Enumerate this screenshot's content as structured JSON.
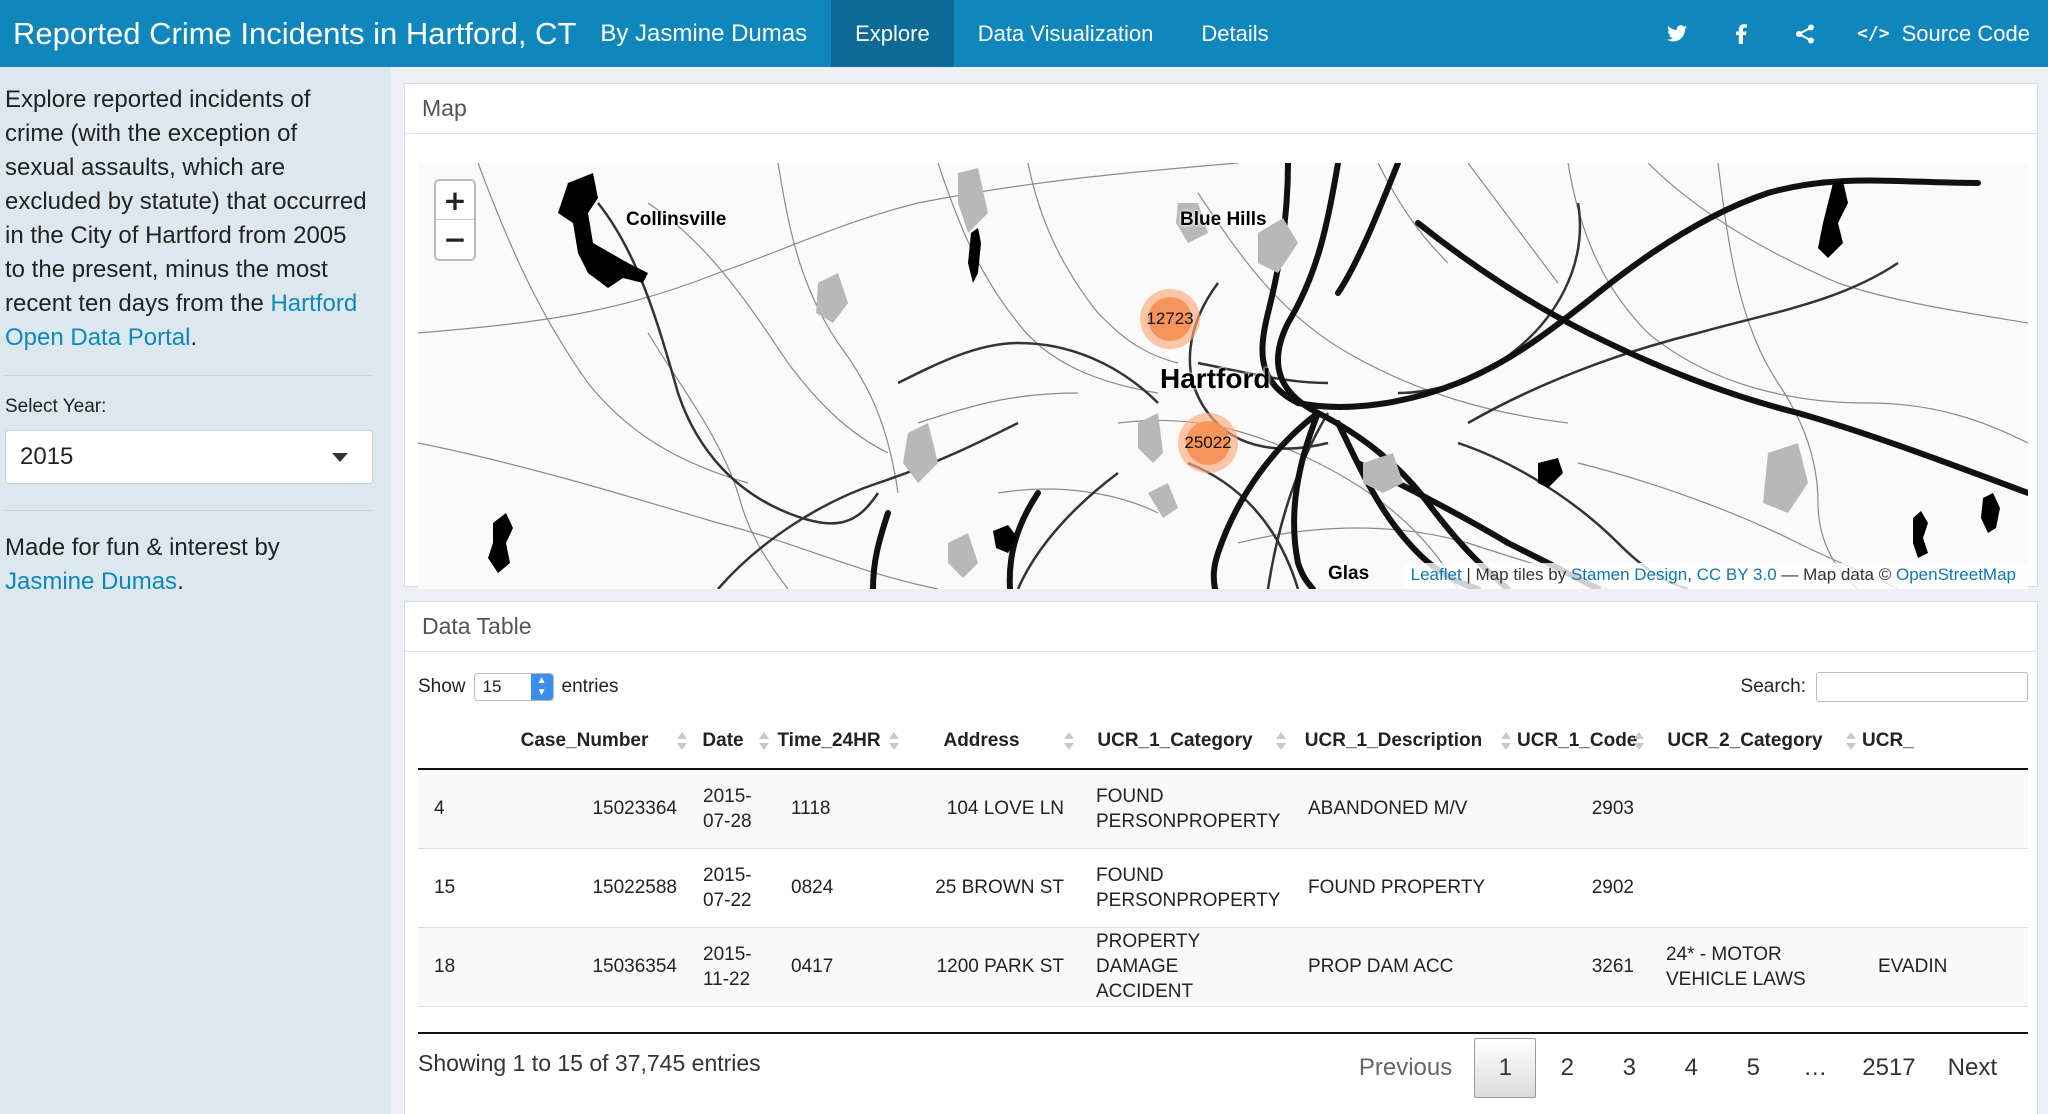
{
  "navbar": {
    "title": "Reported Crime Incidents in Hartford, CT",
    "byline": "By Jasmine Dumas",
    "tabs": [
      {
        "label": "Explore",
        "active": true
      },
      {
        "label": "Data Visualization",
        "active": false
      },
      {
        "label": "Details",
        "active": false
      }
    ],
    "icons": [
      "twitter-icon",
      "facebook-icon",
      "share-icon"
    ],
    "source_code_label": "Source Code",
    "accent_color": "#0f87bd"
  },
  "sidebar": {
    "intro_text": "Explore reported incidents of crime (with the exception of sexual assaults, which are excluded by statute) that occurred in the City of Hartford from 2005 to the present, minus the most recent ten days from the ",
    "intro_link": "Hartford Open Data Portal",
    "intro_end": ".",
    "select_label": "Select Year:",
    "selected_year": "2015",
    "footer_text": "Made for fun & interest by ",
    "footer_link": "Jasmine Dumas",
    "footer_end": "."
  },
  "map": {
    "heading": "Map",
    "zoom_in": "+",
    "zoom_out": "−",
    "places": [
      "Collinsville",
      "Blue Hills",
      "Hartford",
      "Glas"
    ],
    "clusters": [
      "12723",
      "25022"
    ],
    "attribution": {
      "leaflet": "Leaflet",
      "tiles_text": " | Map tiles by ",
      "stamen": "Stamen Design",
      "sep": ", ",
      "license": "CC BY 3.0",
      "data_text": " — Map data © ",
      "osm": "OpenStreetMap"
    }
  },
  "table": {
    "heading": "Data Table",
    "show_label": "Show",
    "page_length": "15",
    "entries_label": "entries",
    "search_label": "Search:",
    "search_value": "",
    "columns": [
      "",
      "Case_Number",
      "Date",
      "Time_24HR",
      "Address",
      "UCR_1_Category",
      "UCR_1_Description",
      "UCR_1_Code",
      "UCR_2_Category",
      "UCR_"
    ],
    "rows": [
      [
        "4",
        "15023364",
        "2015-07-28",
        "1118",
        "104 LOVE LN",
        "FOUND PERSONPROPERTY",
        "ABANDONED M/V",
        "2903",
        "",
        ""
      ],
      [
        "15",
        "15022588",
        "2015-07-22",
        "0824",
        "25 BROWN ST",
        "FOUND PERSONPROPERTY",
        "FOUND PROPERTY",
        "2902",
        "",
        ""
      ],
      [
        "18",
        "15036354",
        "2015-11-22",
        "0417",
        "1200 PARK ST",
        "PROPERTY DAMAGE ACCIDENT",
        "PROP DAM ACC",
        "3261",
        "24* - MOTOR VEHICLE LAWS",
        "EVADIN"
      ]
    ],
    "info": "Showing 1 to 15 of 37,745 entries",
    "pagination": {
      "previous": "Previous",
      "pages": [
        "1",
        "2",
        "3",
        "4",
        "5"
      ],
      "ellipsis": "…",
      "last": "2517",
      "next": "Next",
      "current": "1"
    }
  }
}
